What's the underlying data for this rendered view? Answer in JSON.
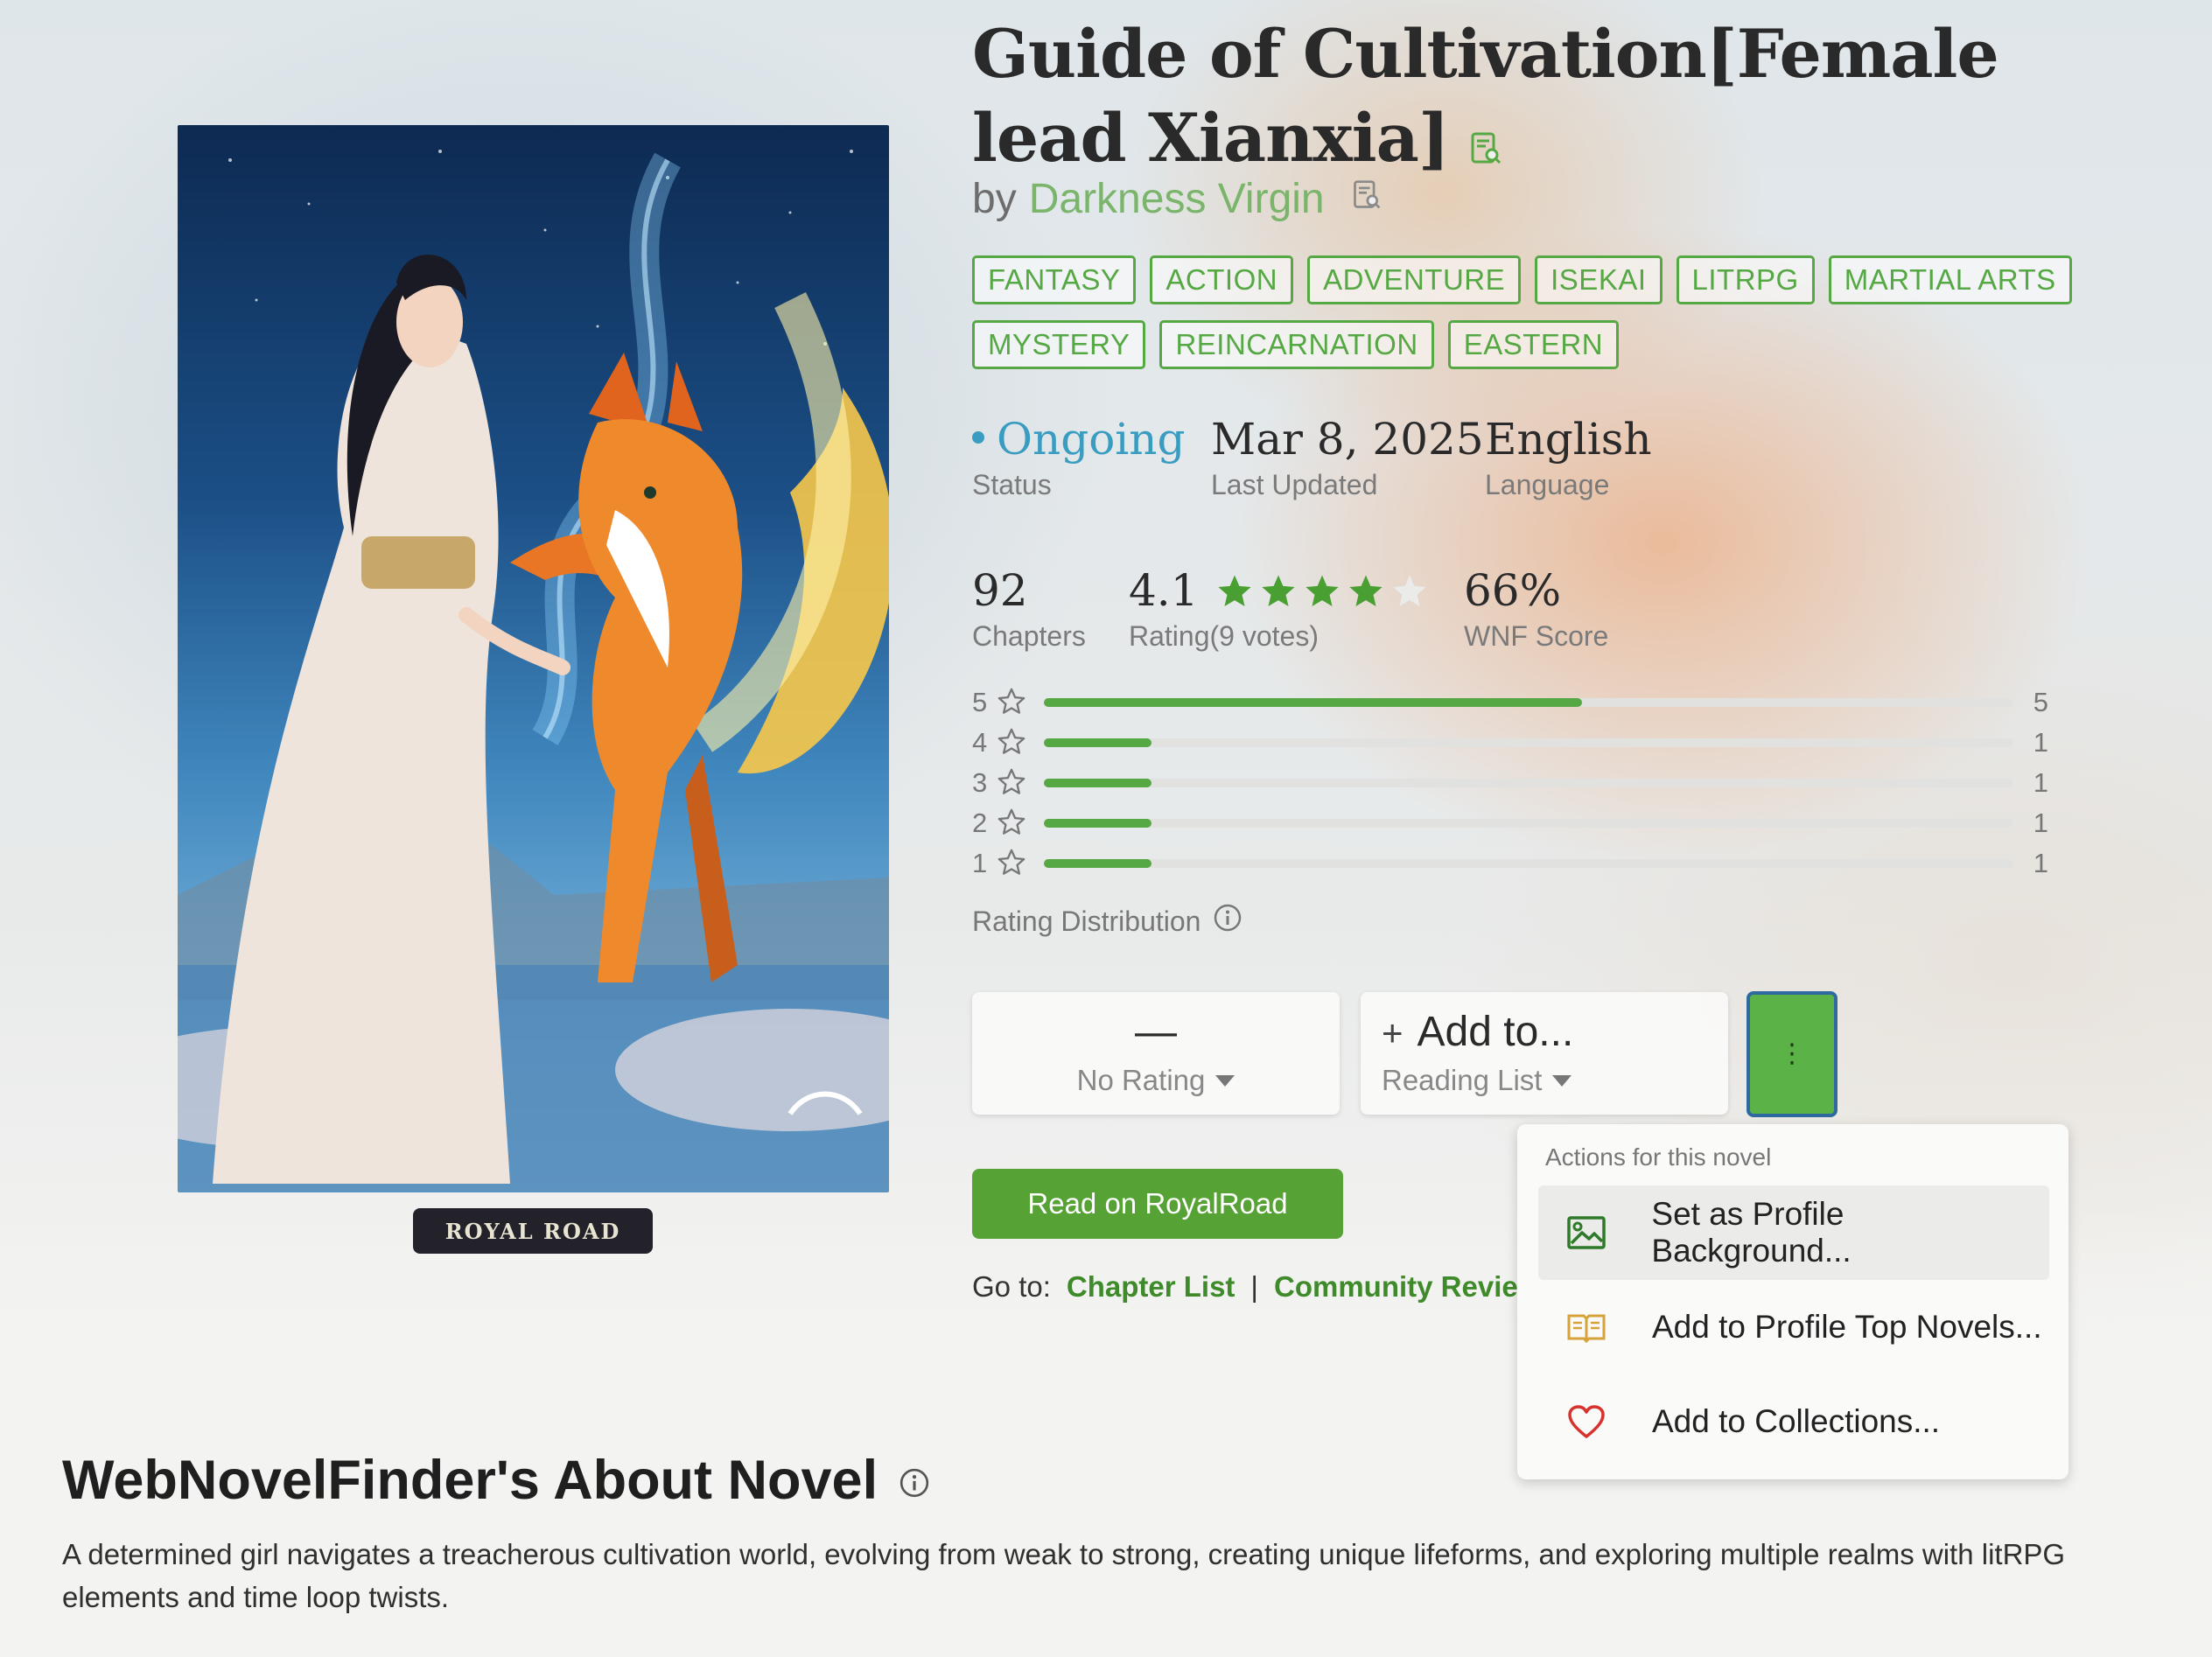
{
  "novel": {
    "title": "Guide of Cultivation[Female lead Xianxia]",
    "by_label": "by",
    "author": "Darkness Virgin",
    "tags_row1": [
      "FANTASY",
      "ACTION",
      "ADVENTURE",
      "ISEKAI",
      "LITRPG",
      "MARTIAL ARTS"
    ],
    "tags_row2": [
      "MYSTERY",
      "REINCARNATION",
      "EASTERN"
    ],
    "cover_badge": "ROYAL ROAD"
  },
  "stats": {
    "status_value": "Ongoing",
    "status_label": "Status",
    "updated_value": "Mar 8, 2025",
    "updated_label": "Last Updated",
    "language_value": "English",
    "language_label": "Language",
    "chapters_value": "92",
    "chapters_label": "Chapters",
    "rating_value": "4.1",
    "rating_label": "Rating(9 votes)",
    "rating_stars_filled": 4,
    "rating_stars_total": 5,
    "score_value": "66%",
    "score_label": "WNF Score"
  },
  "distribution": {
    "label": "Rating Distribution",
    "rows": [
      {
        "stars": "5",
        "count": "5",
        "fraction": 0.555
      },
      {
        "stars": "4",
        "count": "1",
        "fraction": 0.111
      },
      {
        "stars": "3",
        "count": "1",
        "fraction": 0.111
      },
      {
        "stars": "2",
        "count": "1",
        "fraction": 0.111
      },
      {
        "stars": "1",
        "count": "1",
        "fraction": 0.111
      }
    ]
  },
  "controls": {
    "rating_main": "—",
    "rating_sub": "No Rating",
    "list_main": "Add to...",
    "list_sub": "Reading List",
    "more_label": "⋮",
    "read_button": "Read on RoyalRoad",
    "goto_label": "Go to:",
    "goto_chapters": "Chapter List",
    "goto_separator": "|",
    "goto_reviews": "Community Reviews"
  },
  "menu": {
    "heading": "Actions for this novel",
    "items": [
      {
        "label": "Set as Profile Background..."
      },
      {
        "label": "Add to Profile Top Novels..."
      },
      {
        "label": "Add to Collections..."
      }
    ]
  },
  "about": {
    "heading": "WebNovelFinder's About Novel",
    "text": "A determined girl navigates a treacherous cultivation world, evolving from weak to strong, creating unique lifeforms, and exploring multiple realms with litRPG elements and time loop twists."
  },
  "colors": {
    "accent_green": "#56a844",
    "author_green": "#7bb56c",
    "status_blue": "#3a9cc0",
    "star_gold": "#4a9f33",
    "heart_red": "#d8322c",
    "book_gold": "#d8a23a"
  }
}
